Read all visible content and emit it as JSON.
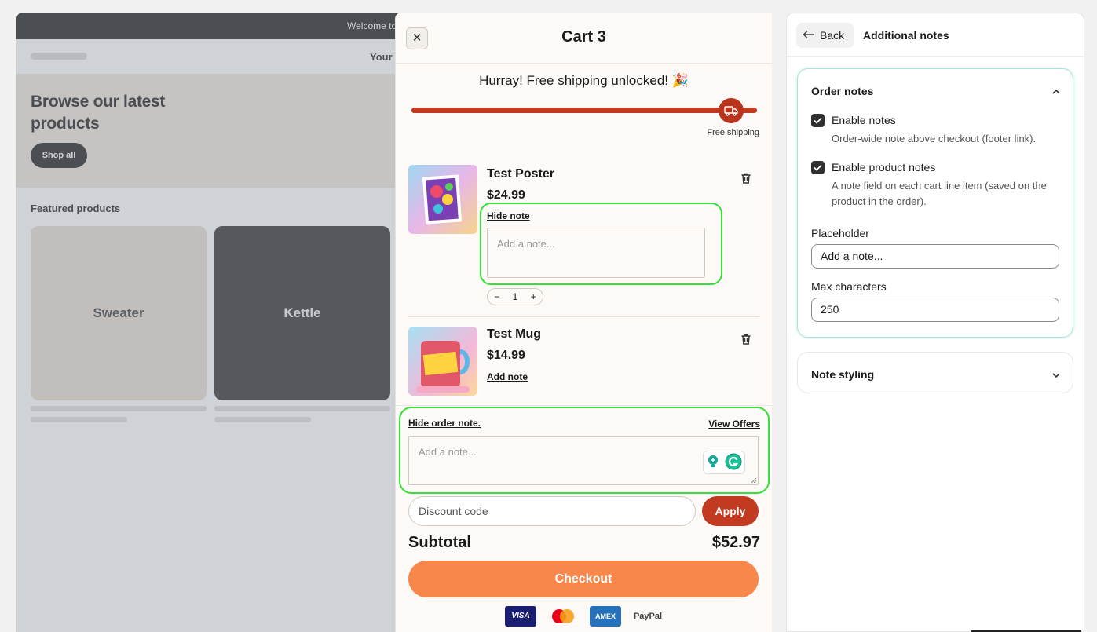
{
  "preview": {
    "announcement": "Welcome to",
    "header_text": "Your s",
    "hero_title": "Browse our latest products",
    "hero_button": "Shop all",
    "featured_title": "Featured products",
    "products": [
      "Sweater",
      "Kettle"
    ]
  },
  "cart": {
    "close_icon": "close-icon",
    "title": "Cart 3",
    "shipping_message": "Hurray! Free shipping unlocked! 🎉",
    "shipping_progress": 1.0,
    "free_shipping_label": "Free shipping",
    "items": [
      {
        "name": "Test Poster",
        "price": "$24.99",
        "note_toggle": "Hide note",
        "note_placeholder": "Add a note...",
        "qty_minus": "−",
        "qty": "1",
        "qty_plus": "+"
      },
      {
        "name": "Test Mug",
        "price": "$14.99",
        "note_toggle": "Add note"
      }
    ],
    "order_note": {
      "toggle": "Hide order note.",
      "offers": "View Offers",
      "placeholder": "Add a note..."
    },
    "discount_placeholder": "Discount code",
    "apply_label": "Apply",
    "subtotal_label": "Subtotal",
    "subtotal_value": "$52.97",
    "checkout_label": "Checkout",
    "payment_methods": [
      "VISA",
      "Mastercard",
      "AMEX",
      "PayPal"
    ],
    "accent_color": "#c23a20",
    "checkout_color": "#f7874a"
  },
  "settings": {
    "back_label": "Back",
    "title": "Additional notes",
    "order_notes": {
      "title": "Order notes",
      "enable_notes_label": "Enable notes",
      "enable_notes_help": "Order-wide note above checkout (footer link).",
      "enable_product_notes_label": "Enable product notes",
      "enable_product_notes_help": "A note field on each cart line item (saved on the product in the order).",
      "placeholder_label": "Placeholder",
      "placeholder_value": "Add a note...",
      "max_chars_label": "Max characters",
      "max_chars_value": "250"
    },
    "note_styling": {
      "title": "Note styling"
    }
  }
}
